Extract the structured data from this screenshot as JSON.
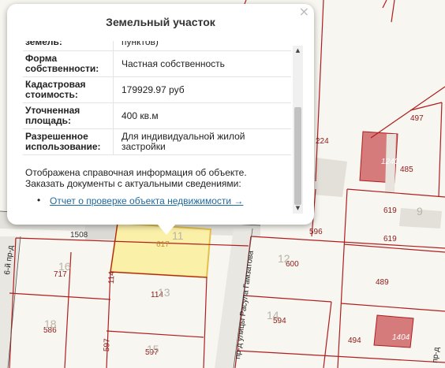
{
  "popup": {
    "title": "Земельный участок",
    "close_label": "×",
    "cut_row": {
      "key": "земель:",
      "value": "пунктов)"
    },
    "rows": [
      {
        "key": "Форма собственности:",
        "value": "Частная собственность"
      },
      {
        "key": "Кадастровая стоимость:",
        "value": "179929.97 руб"
      },
      {
        "key": "Уточненная площадь:",
        "value": "400 кв.м"
      },
      {
        "key": "Разрешенное использование:",
        "value": "Для индивидуальной жилой застройки"
      }
    ],
    "notice_line1": "Отображена справочная информация об объекте.",
    "notice_line2": "Заказать документы с актуальными сведениями:",
    "bullet": "•",
    "report_link": "Отчет о проверке объекта недвижимости →",
    "scroll_up": "▲",
    "scroll_down": "▼"
  },
  "map": {
    "parcel_numbers": [
      "1508",
      "617",
      "717",
      "114",
      "114",
      "586",
      "597",
      "597",
      "596",
      "600",
      "619",
      "619",
      "489",
      "594",
      "494",
      "497",
      "485",
      "1240",
      "1404",
      "224"
    ],
    "block_numbers": [
      "11",
      "16",
      "13",
      "18",
      "15",
      "12",
      "14",
      "9"
    ],
    "streets": [
      "6-й пр-д",
      "пр-д улицы Расула Гамзатова",
      "пр-д"
    ],
    "colors": {
      "highlight": "#fbf0a8",
      "building": "#d67b7b",
      "boundary": "#b01e1e"
    }
  }
}
